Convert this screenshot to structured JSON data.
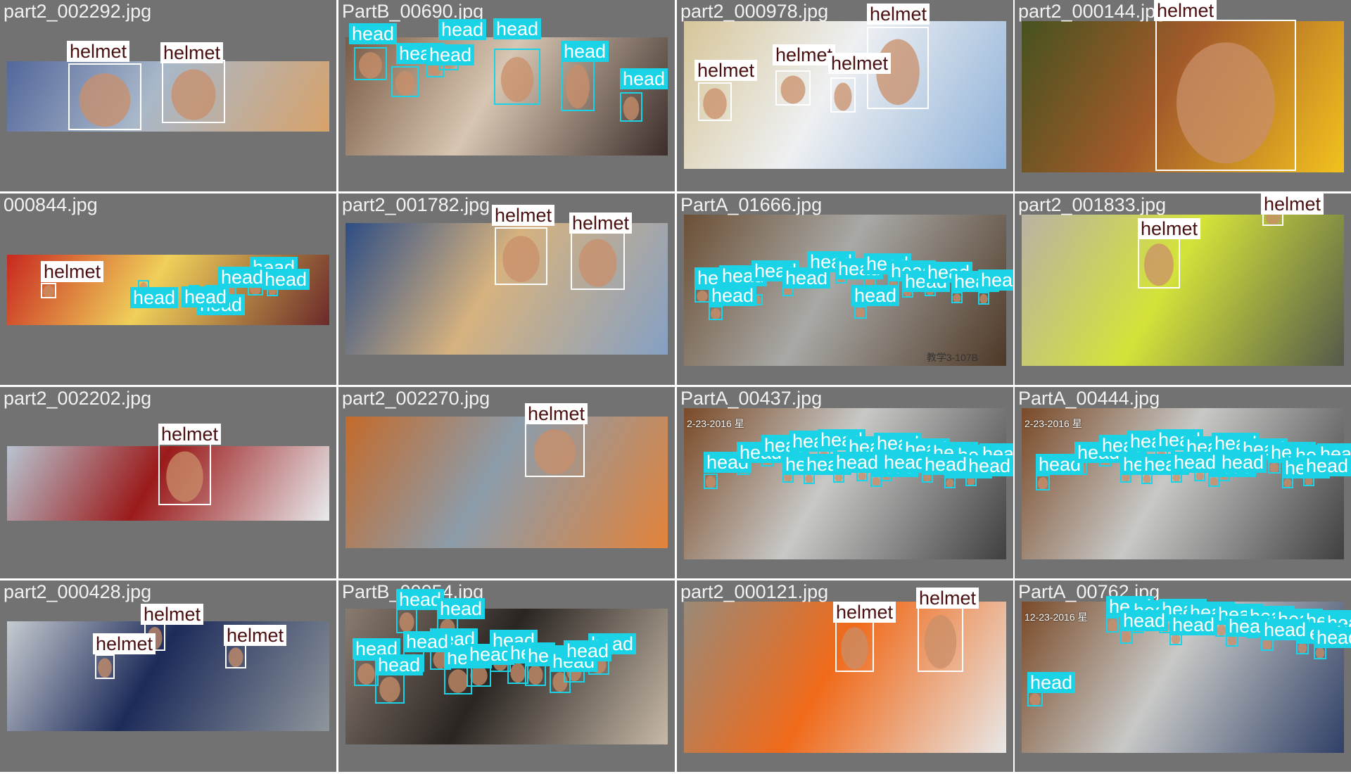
{
  "colors": {
    "helmet": "#ffffff",
    "head": "#1ad3e6",
    "tile_bg": "#727272"
  },
  "tiles": [
    {
      "filename": "part2_002292.jpg",
      "scene": "two smiling men in yellow hard hats",
      "palette": [
        "#53679b",
        "#a9b8c9",
        "#d8a26a"
      ],
      "detections": [
        {
          "label": "helmet"
        },
        {
          "label": "helmet"
        }
      ]
    },
    {
      "filename": "PartB_00690.jpg",
      "scene": "students in a classroom",
      "palette": [
        "#7a5b45",
        "#d7c6b2",
        "#3c2d2a"
      ],
      "detections": [
        {
          "label": "head"
        },
        {
          "label": "head"
        },
        {
          "label": "head"
        },
        {
          "label": "head"
        },
        {
          "label": "head"
        },
        {
          "label": "head"
        },
        {
          "label": "head"
        }
      ]
    },
    {
      "filename": "part2_000978.jpg",
      "scene": "workers in white hard hats",
      "palette": [
        "#d7c69a",
        "#eef0f2",
        "#8db0d8"
      ],
      "detections": [
        {
          "label": "helmet"
        },
        {
          "label": "helmet"
        },
        {
          "label": "helmet"
        },
        {
          "label": "helmet"
        }
      ]
    },
    {
      "filename": "part2_000144.jpg",
      "scene": "close-up woman in yellow hard hat",
      "palette": [
        "#46521f",
        "#a35a2a",
        "#f2c21e"
      ],
      "detections": [
        {
          "label": "helmet"
        }
      ]
    },
    {
      "filename": "000844.jpg",
      "scene": "red banner event",
      "palette": [
        "#c8281f",
        "#f0d05a",
        "#6a2a2a"
      ],
      "detections": [
        {
          "label": "helmet"
        },
        {
          "label": "head"
        },
        {
          "label": "head"
        },
        {
          "label": "head"
        },
        {
          "label": "head"
        },
        {
          "label": "head"
        },
        {
          "label": "head"
        }
      ]
    },
    {
      "filename": "part2_001782.jpg",
      "scene": "engineers with tablet at oil rig",
      "palette": [
        "#2d4d84",
        "#d6b27f",
        "#85a0c4"
      ],
      "detections": [
        {
          "label": "helmet"
        },
        {
          "label": "helmet"
        }
      ]
    },
    {
      "filename": "PartA_01666.jpg",
      "scene": "lecture hall with seats",
      "palette": [
        "#6b4f35",
        "#a9a9a6",
        "#4e3826"
      ],
      "detections": [
        {
          "label": "head"
        },
        {
          "label": "head"
        },
        {
          "label": "head"
        },
        {
          "label": "head"
        },
        {
          "label": "head"
        },
        {
          "label": "head"
        },
        {
          "label": "head"
        },
        {
          "label": "head"
        },
        {
          "label": "head"
        },
        {
          "label": "head"
        },
        {
          "label": "head"
        },
        {
          "label": "head"
        },
        {
          "label": "head"
        },
        {
          "label": "head"
        }
      ],
      "caption": "教学3-107B"
    },
    {
      "filename": "part2_001833.jpg",
      "scene": "worker in hi-vis vest",
      "palette": [
        "#b9b2a4",
        "#d4e33a",
        "#54594a"
      ],
      "detections": [
        {
          "label": "helmet"
        },
        {
          "label": "helmet"
        }
      ]
    },
    {
      "filename": "part2_002202.jpg",
      "scene": "woman in orange hard hat at pipes",
      "palette": [
        "#b8c4d1",
        "#9b1a1a",
        "#e8ebee"
      ],
      "detections": [
        {
          "label": "helmet"
        }
      ]
    },
    {
      "filename": "part2_002270.jpg",
      "scene": "worker in orange on crane",
      "palette": [
        "#c46a2a",
        "#8c9caa",
        "#e3833a"
      ],
      "detections": [
        {
          "label": "helmet"
        }
      ]
    },
    {
      "filename": "PartA_00437.jpg",
      "scene": "surveillance view of lecture hall",
      "palette": [
        "#7a4a28",
        "#c8c9c7",
        "#3f3f3f"
      ],
      "detections": [
        {
          "label": "head"
        },
        {
          "label": "head"
        },
        {
          "label": "head"
        },
        {
          "label": "head"
        },
        {
          "label": "head"
        },
        {
          "label": "head"
        },
        {
          "label": "head"
        },
        {
          "label": "head"
        },
        {
          "label": "head"
        },
        {
          "label": "head"
        },
        {
          "label": "head"
        },
        {
          "label": "head"
        },
        {
          "label": "head"
        },
        {
          "label": "head"
        },
        {
          "label": "head"
        },
        {
          "label": "head"
        },
        {
          "label": "head"
        },
        {
          "label": "head"
        },
        {
          "label": "head"
        },
        {
          "label": "head"
        }
      ],
      "caption": "2-23-2016 星"
    },
    {
      "filename": "PartA_00444.jpg",
      "scene": "surveillance view of lecture hall",
      "palette": [
        "#7a4a28",
        "#c8c9c7",
        "#3f3f3f"
      ],
      "detections": [
        {
          "label": "head"
        },
        {
          "label": "head"
        },
        {
          "label": "head"
        },
        {
          "label": "head"
        },
        {
          "label": "head"
        },
        {
          "label": "head"
        },
        {
          "label": "head"
        },
        {
          "label": "head"
        },
        {
          "label": "head"
        },
        {
          "label": "head"
        },
        {
          "label": "head"
        },
        {
          "label": "head"
        },
        {
          "label": "head"
        },
        {
          "label": "head"
        },
        {
          "label": "head"
        },
        {
          "label": "head"
        },
        {
          "label": "head"
        },
        {
          "label": "head"
        },
        {
          "label": "head"
        }
      ],
      "caption": "2-23-2016 星"
    },
    {
      "filename": "part2_000428.jpg",
      "scene": "three workers in blue coveralls",
      "palette": [
        "#c7ccd1",
        "#1d2b5a",
        "#8f969c"
      ],
      "detections": [
        {
          "label": "helmet"
        },
        {
          "label": "helmet"
        },
        {
          "label": "helmet"
        }
      ]
    },
    {
      "filename": "PartB_00054.jpg",
      "scene": "audience in a seminar",
      "palette": [
        "#8a7b70",
        "#2a2522",
        "#c7b9a8"
      ],
      "detections": [
        {
          "label": "head"
        },
        {
          "label": "head"
        },
        {
          "label": "head"
        },
        {
          "label": "head"
        },
        {
          "label": "head"
        },
        {
          "label": "head"
        },
        {
          "label": "head"
        },
        {
          "label": "head"
        },
        {
          "label": "head"
        },
        {
          "label": "head"
        },
        {
          "label": "head"
        },
        {
          "label": "head"
        },
        {
          "label": "head"
        },
        {
          "label": "head"
        }
      ]
    },
    {
      "filename": "part2_000121.jpg",
      "scene": "engineers with blueprint at quarry",
      "palette": [
        "#9a8a78",
        "#f06a1a",
        "#e8e8e8"
      ],
      "detections": [
        {
          "label": "helmet"
        },
        {
          "label": "helmet"
        }
      ]
    },
    {
      "filename": "PartA_00762.jpg",
      "scene": "surveillance view of lecture hall",
      "palette": [
        "#7a4a28",
        "#c8c9c7",
        "#2f3f66"
      ],
      "detections": [
        {
          "label": "head"
        },
        {
          "label": "head"
        },
        {
          "label": "head"
        },
        {
          "label": "head"
        },
        {
          "label": "head"
        },
        {
          "label": "head"
        },
        {
          "label": "head"
        },
        {
          "label": "head"
        },
        {
          "label": "head"
        },
        {
          "label": "head"
        },
        {
          "label": "head"
        },
        {
          "label": "head"
        },
        {
          "label": "head"
        },
        {
          "label": "head"
        },
        {
          "label": "head"
        },
        {
          "label": "head"
        }
      ],
      "caption": "12-23-2016 星"
    }
  ]
}
